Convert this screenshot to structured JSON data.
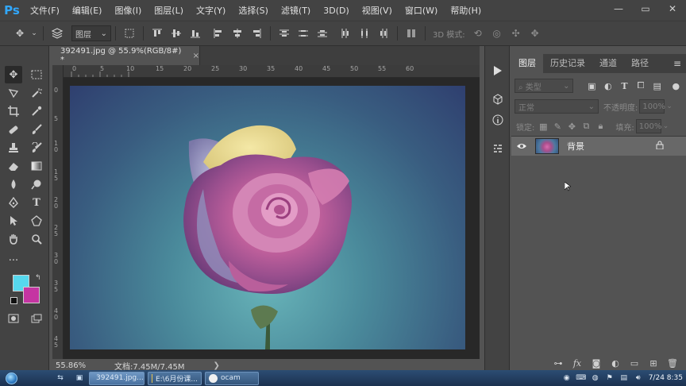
{
  "app": {
    "logo": "Ps"
  },
  "menu": [
    "文件(F)",
    "编辑(E)",
    "图像(I)",
    "图层(L)",
    "文字(Y)",
    "选择(S)",
    "滤镜(T)",
    "3D(D)",
    "视图(V)",
    "窗口(W)",
    "帮助(H)"
  ],
  "window_controls": {
    "minimize": "—",
    "restore": "▭",
    "close": "✕"
  },
  "options_bar": {
    "layer_select": "图层",
    "mode3d_label": "3D 模式:"
  },
  "document": {
    "tab_title": "392491.jpg @ 55.9%(RGB/8#) *",
    "close_glyph": "×",
    "ruler_h": [
      "0",
      "5",
      "10",
      "15",
      "20",
      "25",
      "30",
      "35",
      "40",
      "45",
      "50",
      "55",
      "60"
    ],
    "ruler_v": [
      "0",
      "5",
      "10",
      "15",
      "20",
      "25",
      "30",
      "35",
      "40",
      "45"
    ],
    "zoom": "55.86%",
    "doc_info": "文档:7.45M/7.45M",
    "status_arrow": "❯"
  },
  "colors": {
    "foreground": "#56d8ee",
    "background": "#c535a2"
  },
  "layers_panel": {
    "tabs": [
      "图层",
      "历史记录",
      "通道",
      "路径"
    ],
    "active_tab": 0,
    "filter_placeholder": "类型",
    "blend_mode": "正常",
    "opacity_label": "不透明度:",
    "opacity_value": "100%",
    "lock_label": "锁定:",
    "fill_label": "填充:",
    "fill_value": "100%",
    "layers": [
      {
        "name": "背景",
        "visible": true,
        "locked": true
      }
    ]
  },
  "taskbar": {
    "items": [
      {
        "label": "392491.jpg...",
        "active": true,
        "icon": "photoshop-icon",
        "color": "#2f6fb5"
      },
      {
        "label": "E:\\6月份课...",
        "active": false,
        "icon": "folder-icon",
        "color": "#e8c24d"
      },
      {
        "label": "ocam",
        "active": false,
        "icon": "ocam-icon",
        "color": "#f0f0f0"
      }
    ],
    "clock": "7/24 8:35"
  }
}
